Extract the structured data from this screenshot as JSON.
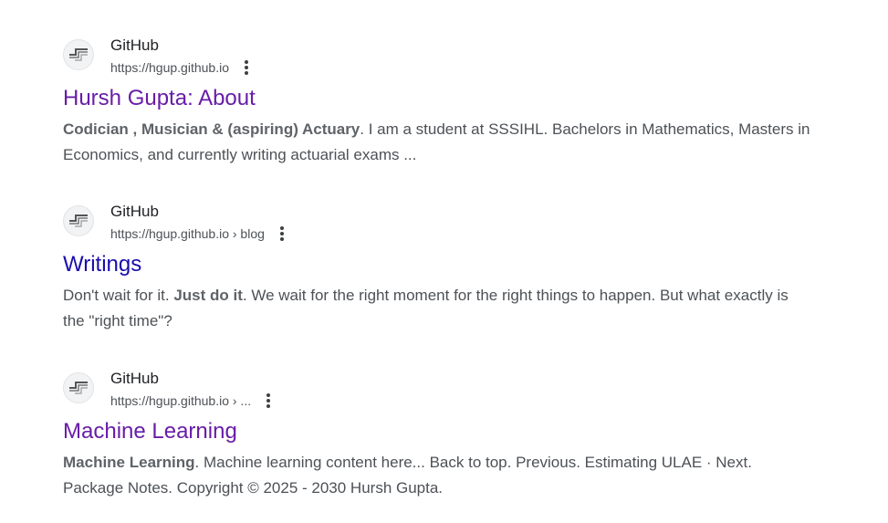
{
  "results": [
    {
      "site_name": "GitHub",
      "url": "https://hgup.github.io",
      "title": "Hursh Gupta: About",
      "title_color": "#681da8",
      "snippet": {
        "b1": "Codician , Musician & (aspiring) Actuary",
        "t1": ". I am a student at SSSIHL. Bachelors in Mathematics, Masters in Economics, and currently writing actuarial exams ..."
      }
    },
    {
      "site_name": "GitHub",
      "url": "https://hgup.github.io › blog",
      "title": "Writings",
      "title_color": "#1a0dab",
      "snippet": {
        "t0": "Don't wait for it. ",
        "b1": "Just do it",
        "t1": ". We wait for the right moment for the right things to happen. But what exactly is the \"right time\"?"
      }
    },
    {
      "site_name": "GitHub",
      "url": "https://hgup.github.io › ...",
      "title": "Machine Learning",
      "title_color": "#681da8",
      "snippet": {
        "b1": "Machine Learning",
        "t1": ". Machine learning content here... Back to top. Previous. Estimating ULAE · Next. Package Notes. Copyright © 2025 - 2030 Hursh Gupta."
      }
    }
  ],
  "icons": {
    "favicon": "site-favicon-icon",
    "menu": "more-vertical-icon"
  }
}
